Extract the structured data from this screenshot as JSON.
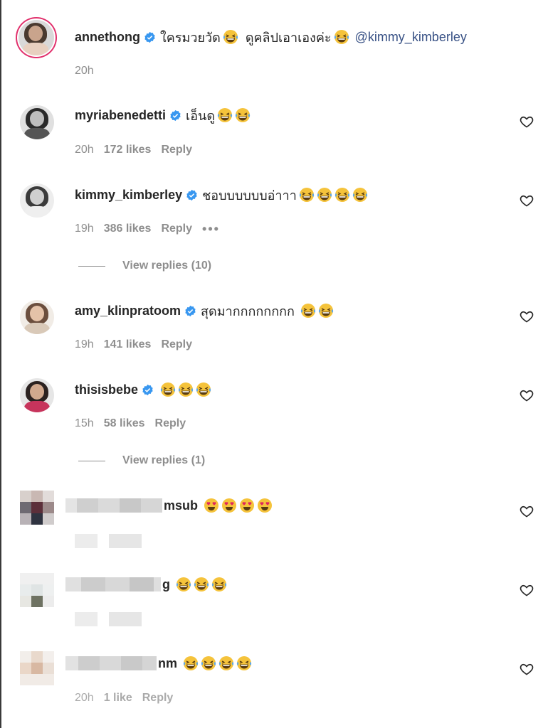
{
  "comments": [
    {
      "username": "annethong",
      "verified": true,
      "text1": "ใครมวยวัด",
      "text2": "ดูคลิปเอาเองค่ะ",
      "mention": "@kimmy_kimberley",
      "time": "20h"
    },
    {
      "username": "myriabenedetti",
      "verified": true,
      "text": "เอ็นดู",
      "time": "20h",
      "likes": "172 likes",
      "reply": "Reply"
    },
    {
      "username": "kimmy_kimberley",
      "verified": true,
      "text": "ชอบบบบบบอ่าาา",
      "time": "19h",
      "likes": "386 likes",
      "reply": "Reply",
      "more": "•••",
      "view_replies": "View replies (10)"
    },
    {
      "username": "amy_klinpratoom",
      "verified": true,
      "text": "สุดมากกกกกกกก",
      "time": "19h",
      "likes": "141 likes",
      "reply": "Reply"
    },
    {
      "username": "thisisbebe",
      "verified": true,
      "text": "",
      "time": "15h",
      "likes": "58 likes",
      "reply": "Reply",
      "view_replies": "View replies (1)"
    },
    {
      "username_visible": "msub"
    },
    {
      "username_visible": "g"
    },
    {
      "username_visible": "nm",
      "time": "20h",
      "likes": "1 like",
      "reply": "Reply"
    }
  ],
  "icons": {
    "verified": "verified-badge-icon",
    "heart": "heart-outline-icon",
    "emoji_laugh": "grinning-squinting-tears-emoji",
    "emoji_hearts": "heart-eyes-emoji"
  },
  "colors": {
    "verified": "#3897f0",
    "mention": "#385185",
    "meta": "#8e8e8e",
    "username": "#262626"
  }
}
